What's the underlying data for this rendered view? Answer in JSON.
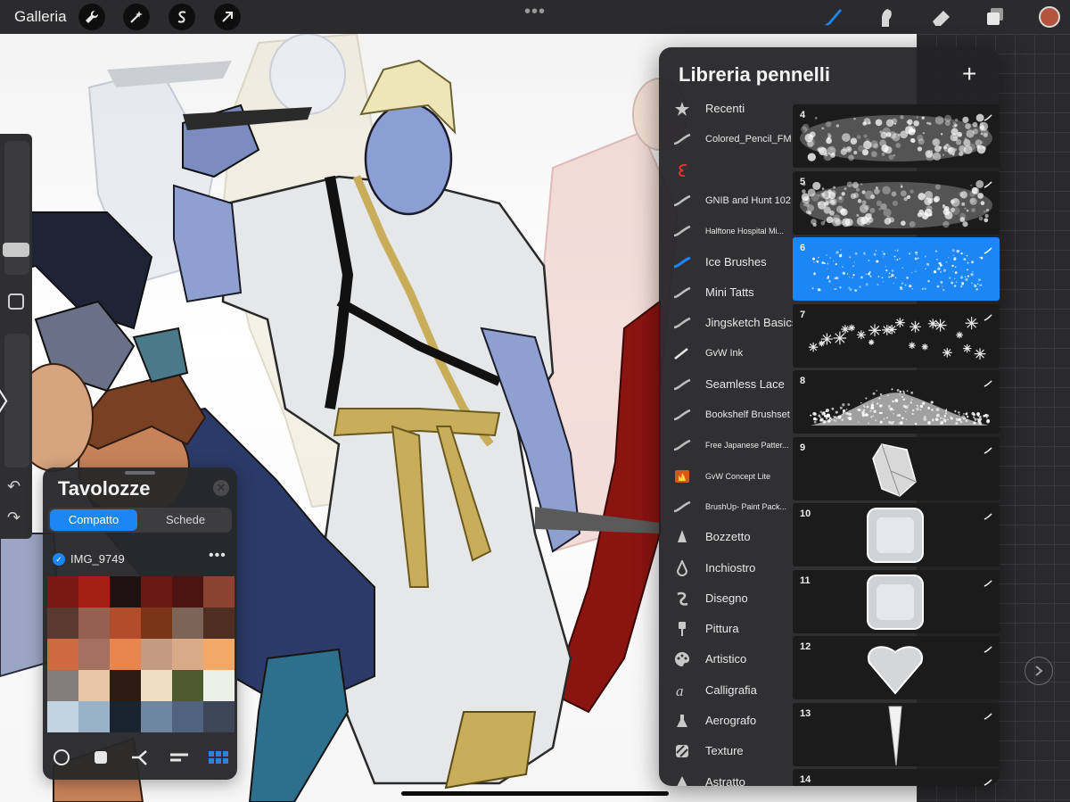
{
  "topbar": {
    "gallery_label": "Galleria",
    "tools_left": [
      {
        "name": "wrench-icon"
      },
      {
        "name": "magic-wand-icon"
      },
      {
        "name": "selection-s-icon"
      },
      {
        "name": "transform-arrow-icon"
      }
    ],
    "more_dots": "•••",
    "tools_right": [
      {
        "name": "brush-icon",
        "active": true
      },
      {
        "name": "smudge-icon"
      },
      {
        "name": "eraser-icon"
      },
      {
        "name": "layers-icon"
      }
    ],
    "current_color": "#b5543e"
  },
  "left_sidebar": {
    "undo_icon": "↶",
    "redo_icon": "↷",
    "expand_icon": "〉"
  },
  "palette": {
    "title": "Tavolozze",
    "close_icon": "✕",
    "tab_compact": "Compatto",
    "tab_cards": "Schede",
    "selected_palette": "IMG_9749",
    "more_icon": "•••",
    "swatches": [
      "#7a1812",
      "#a22016",
      "#1e1210",
      "#6a1812",
      "#4c1410",
      "#8c4230",
      "#5a3a30",
      "#966050",
      "#b24c2a",
      "#7c3418",
      "#7c6458",
      "#4e2e20",
      "#cc6a40",
      "#a47060",
      "#e8844e",
      "#c49a82",
      "#d8aa88",
      "#f2a868",
      "#847c78",
      "#e6c6a6",
      "#2e1c14",
      "#f0dec2",
      "#4c5a2e",
      "#ecefe6",
      "#c2d4e2",
      "#9ab2c8",
      "#1a2430",
      "#6e86a0",
      "#50627e",
      "#3c4656"
    ],
    "mode_icons": [
      "circle-mode-icon",
      "square-mode-icon",
      "harmony-mode-icon",
      "value-mode-icon",
      "palettes-mode-icon"
    ]
  },
  "brush_library": {
    "title": "Libreria pennelli",
    "add_icon": "+",
    "sets": [
      {
        "label": "Recenti",
        "icon": "star-icon",
        "size": "normal"
      },
      {
        "label": "Colored_Pencil_FM",
        "icon": "stroke-icon",
        "size": "med"
      },
      {
        "label": "",
        "icon": "red-swirl-icon",
        "size": "normal"
      },
      {
        "label": "GNIB and Hunt 102",
        "icon": "stroke-icon",
        "size": "med"
      },
      {
        "label": "Halftone Hospital Mi...",
        "icon": "stroke-icon",
        "size": "small"
      },
      {
        "label": "Ice Brushes",
        "icon": "stroke-icon",
        "size": "normal",
        "active": true
      },
      {
        "label": "Mini Tatts",
        "icon": "stroke-icon",
        "size": "normal"
      },
      {
        "label": "Jingsketch Basics",
        "icon": "stroke-icon",
        "size": "normal"
      },
      {
        "label": "GvW Ink",
        "icon": "pen-icon",
        "size": "med"
      },
      {
        "label": "Seamless Lace",
        "icon": "stroke-icon",
        "size": "normal"
      },
      {
        "label": "Bookshelf Brushset",
        "icon": "stroke-icon",
        "size": "med"
      },
      {
        "label": "Free Japanese Patter...",
        "icon": "stroke-icon",
        "size": "small"
      },
      {
        "label": "GvW Concept Lite",
        "icon": "flame-icon",
        "size": "small"
      },
      {
        "label": "BrushUp- Paint Pack...",
        "icon": "stroke-icon",
        "size": "small"
      },
      {
        "label": "Bozzetto",
        "icon": "pencil-tip-icon",
        "size": "normal"
      },
      {
        "label": "Inchiostro",
        "icon": "ink-drop-icon",
        "size": "normal"
      },
      {
        "label": "Disegno",
        "icon": "swirl-icon",
        "size": "normal"
      },
      {
        "label": "Pittura",
        "icon": "paintbrush-icon",
        "size": "normal"
      },
      {
        "label": "Artistico",
        "icon": "palette-icon",
        "size": "normal"
      },
      {
        "label": "Calligrafia",
        "icon": "calligraphy-icon",
        "size": "normal"
      },
      {
        "label": "Aerografo",
        "icon": "airbrush-icon",
        "size": "normal"
      },
      {
        "label": "Texture",
        "icon": "texture-icon",
        "size": "normal"
      },
      {
        "label": "Astratto",
        "icon": "triangle-icon",
        "size": "normal"
      }
    ],
    "strokes": [
      {
        "number": "4",
        "style": "texture"
      },
      {
        "number": "5",
        "style": "texture2"
      },
      {
        "number": "6",
        "style": "sparkle",
        "selected": true
      },
      {
        "number": "7",
        "style": "snowflakes"
      },
      {
        "number": "8",
        "style": "snow"
      },
      {
        "number": "9",
        "style": "crystal"
      },
      {
        "number": "10",
        "style": "icecube"
      },
      {
        "number": "11",
        "style": "icecube2"
      },
      {
        "number": "12",
        "style": "heart-ice"
      },
      {
        "number": "13",
        "style": "icicle"
      },
      {
        "number": "14",
        "style": "ground"
      }
    ],
    "accent_color": "#1d86f5"
  }
}
